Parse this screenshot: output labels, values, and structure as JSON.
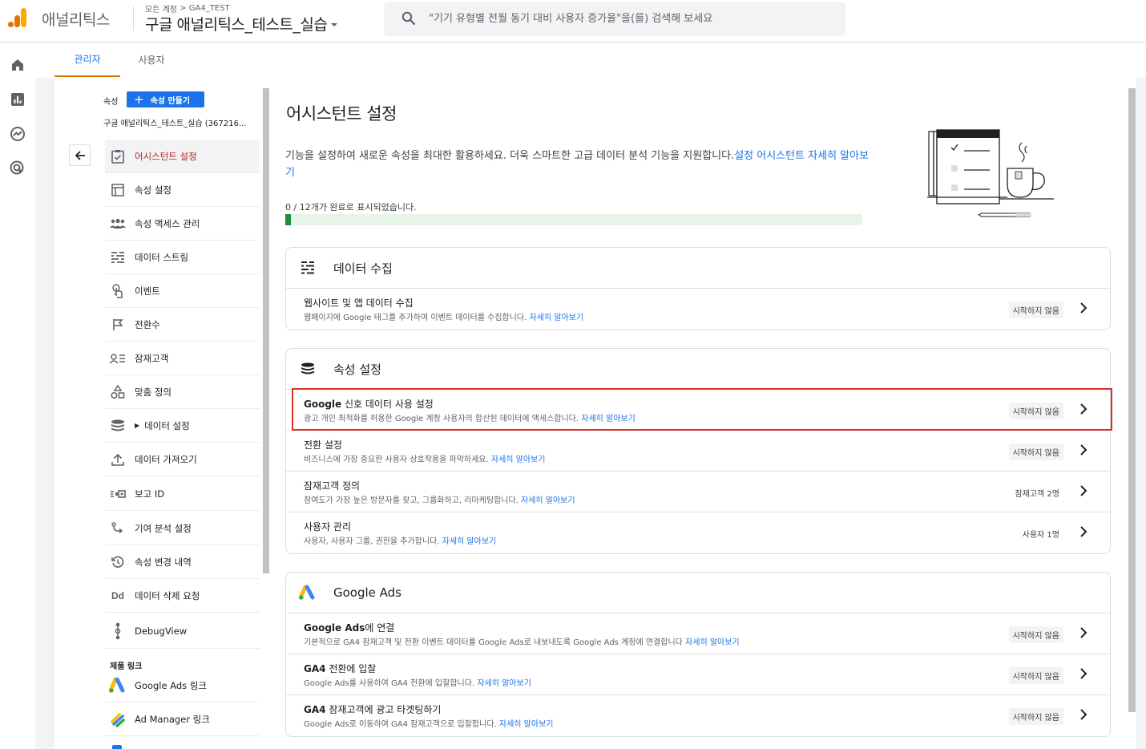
{
  "header": {
    "app_name": "애널리틱스",
    "breadcrumb_root": "모든 계정",
    "breadcrumb_sep": ">",
    "breadcrumb_account": "GA4_TEST",
    "property_name": "구글 애널리틱스_테스트_실습",
    "search_placeholder": "\"기기 유형별 전월 동기 대비 사용자 증가율\"을(를) 검색해 보세요"
  },
  "rail": {
    "icons": [
      "home-icon",
      "reports-icon",
      "explore-icon",
      "advertising-icon"
    ]
  },
  "tabs": [
    {
      "label": "관리자",
      "active": true
    },
    {
      "label": "사용자",
      "active": false
    }
  ],
  "sidebar": {
    "property_label": "속성",
    "create_button": "속성 만들기",
    "property_name": "구글 애널리틱스_테스트_실습 (367216...",
    "items": [
      {
        "label": "어시스턴트 설정",
        "icon": "assistant-check-icon",
        "active": true
      },
      {
        "label": "속성 설정",
        "icon": "property-settings-icon"
      },
      {
        "label": "속성 액세스 관리",
        "icon": "people-icon"
      },
      {
        "label": "데이터 스트림",
        "icon": "data-stream-icon"
      },
      {
        "label": "이벤트",
        "icon": "touch-icon"
      },
      {
        "label": "전환수",
        "icon": "flag-icon"
      },
      {
        "label": "잠재고객",
        "icon": "audience-icon"
      },
      {
        "label": "맞춤 정의",
        "icon": "shapes-icon"
      },
      {
        "label": "데이터 설정",
        "icon": "database-icon",
        "expandable": true
      },
      {
        "label": "데이터 가져오기",
        "icon": "upload-icon"
      },
      {
        "label": "보고 ID",
        "icon": "reporting-id-icon"
      },
      {
        "label": "기여 분석 설정",
        "icon": "attribution-icon"
      },
      {
        "label": "속성 변경 내역",
        "icon": "history-icon"
      },
      {
        "label": "데이터 삭제 요청",
        "icon": "data-deletion-icon"
      },
      {
        "label": "DebugView",
        "icon": "debug-icon"
      }
    ],
    "product_links_header": "제품 링크",
    "links": [
      {
        "label": "Google Ads 링크",
        "icon": "google-ads-icon"
      },
      {
        "label": "Ad Manager 링크",
        "icon": "ad-manager-icon"
      }
    ]
  },
  "main": {
    "title": "어시스턴트 설정",
    "intro": "기능을 설정하여 새로운 속성을 최대한 활용하세요. 더욱 스마트한 고급 데이터 분석 기능을 지원합니다.",
    "intro_link": "설정 어시스턴트 자세히 알아보기",
    "progress_text": "0 / 12개가 완료로 표시되었습니다.",
    "progress_fraction": 0.01,
    "sections": [
      {
        "title": "데이터 수집",
        "icon": "data-stream-icon",
        "rows": [
          {
            "title": "웹사이트 및 앱 데이터 수집",
            "title_bold": "",
            "desc": "웹페이지에 Google 태그를 추가하여 이벤트 데이터를 수집합니다.",
            "link": "자세히 알아보기",
            "status": "시작하지 않음",
            "status_badge": true
          }
        ]
      },
      {
        "title": "속성 설정",
        "icon": "database-icon",
        "rows": [
          {
            "title": " 신호 데이터 사용 설정",
            "title_bold": "Google",
            "desc": "광고 개인 최적화를 허용한 Google 계정 사용자의 합산된 데이터에 액세스합니다.",
            "link": "자세히 알아보기",
            "status": "시작하지 않음",
            "status_badge": true
          },
          {
            "title": "전환 설정",
            "title_bold": "",
            "desc": "비즈니스에 가장 중요한 사용자 상호작용을 파악하세요.",
            "link": "자세히 알아보기",
            "status": "시작하지 않음",
            "status_badge": true
          },
          {
            "title": "잠재고객 정의",
            "title_bold": "",
            "desc": "참여도가 가장 높은 방문자를 찾고, 그룹화하고, 리마케팅합니다.",
            "link": "자세히 알아보기",
            "status": "잠재고객 2명",
            "status_badge": false
          },
          {
            "title": "사용자 관리",
            "title_bold": "",
            "desc": "사용자, 사용자 그룹, 권한을 추가합니다.",
            "link": "자세히 알아보기",
            "status": "사용자 1명",
            "status_badge": false
          }
        ]
      },
      {
        "title": "Google Ads",
        "icon": "google-ads-icon",
        "rows": [
          {
            "title": "에 연결",
            "title_bold": "Google Ads",
            "desc": "기본적으로 GA4 잠재고객 및 전환 이벤트 데이터를 Google Ads로 내보내도록 Google Ads 계정에 연결합니다",
            "link": "자세히 알아보기",
            "status": "시작하지 않음",
            "status_badge": true
          },
          {
            "title": " 전환에 입찰",
            "title_bold": "GA4",
            "desc": "Google Ads를 사용하여 GA4 전환에 입찰합니다.",
            "link": "자세히 알아보기",
            "status": "시작하지 않음",
            "status_badge": true
          },
          {
            "title": " 잠재고객에 광고 타겟팅하기",
            "title_bold": "GA4",
            "desc": "Google Ads로 이동하여 GA4 잠재고객으로 입찰합니다.",
            "link": "자세히 알아보기",
            "status": "시작하지 않음",
            "status_badge": true
          }
        ]
      }
    ]
  },
  "colors": {
    "accent": "#1a73e8",
    "active_nav": "#b3261e",
    "tab_underline": "#e37400",
    "progress_fill": "#1e8e3e",
    "highlight_border": "#d93025"
  }
}
